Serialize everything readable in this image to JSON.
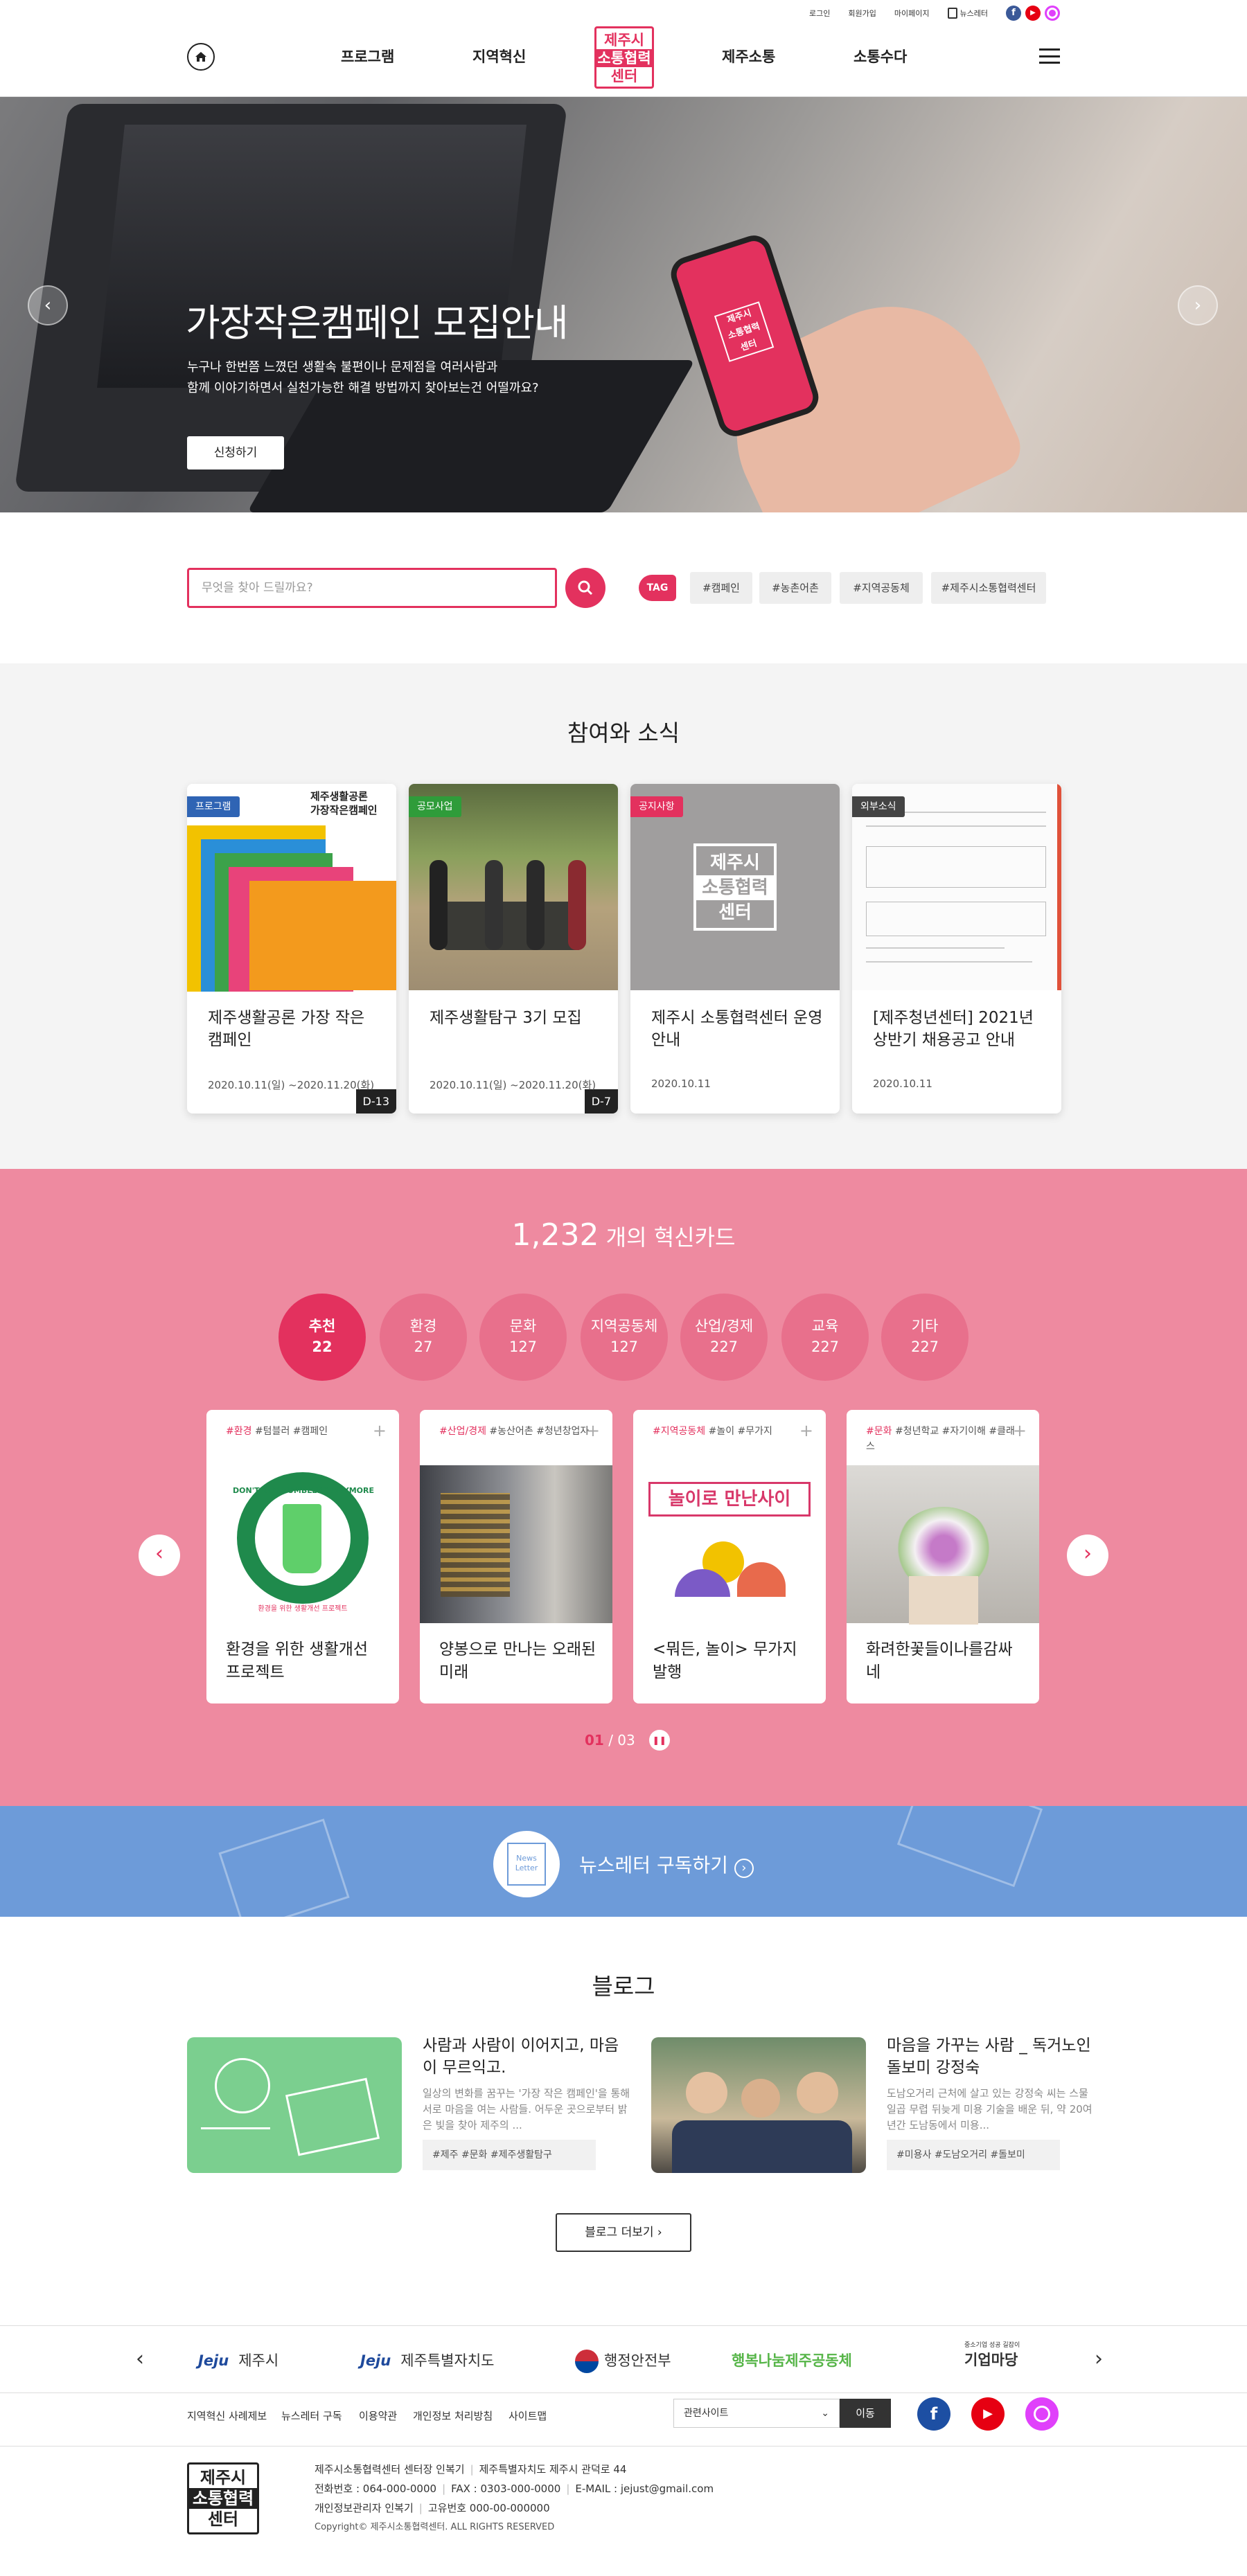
{
  "util": {
    "login": "로그인",
    "join": "회원가입",
    "mypage": "마이페이지",
    "newsletter": "뉴스레터"
  },
  "colors": {
    "accent": "#e3315e",
    "pink_bg": "#ee8aa0",
    "blue_bg": "#6d9bd9",
    "facebook": "#3b5998",
    "youtube": "#e60012",
    "instagram": "#e040fb"
  },
  "header": {
    "nav": [
      "프로그램",
      "지역혁신",
      "제주소통",
      "소통수다"
    ],
    "logo": [
      "제주시",
      "소통협력",
      "센터"
    ]
  },
  "hero": {
    "title": "가장작은캠페인 모집안내",
    "desc1": "누구나 한번쯤 느꼈던 생활속 불편이나 문제점을 여러사람과",
    "desc2": "함께 이야기하면서 실천가능한 해결 방법까지 찾아보는건 어떨까요?",
    "button": "신청하기",
    "slides": 5,
    "active_slide": 1
  },
  "search": {
    "placeholder": "무엇을 찾아 드릴까요?",
    "tag_label": "TAG",
    "tags": [
      "#캠페인",
      "#농촌어촌",
      "#지역공동체",
      "#제주시소통협력센터"
    ]
  },
  "news": {
    "title": "참여와 소식",
    "cards": [
      {
        "badge": "프로그램",
        "badge_color": "#2f64b4",
        "title": "제주생활공론 가장 작은 캠페인",
        "date": "2020.10.11(일) ~2020.11.20(화)",
        "dday": "D-13",
        "poster_title": "제주생활공론\n가장작은캠페인"
      },
      {
        "badge": "공모사업",
        "badge_color": "#2f9c3a",
        "title": "제주생활탐구 3기 모집",
        "date": "2020.10.11(일) ~2020.11.20(화)",
        "dday": "D-7"
      },
      {
        "badge": "공지사항",
        "badge_color": "#e3315e",
        "title": "제주시 소통협력센터 운영안내",
        "date": "2020.10.11",
        "dday": ""
      },
      {
        "badge": "외부소식",
        "badge_color": "#444444",
        "title": "[제주청년센터] 2021년 상반기 채용공고 안내",
        "date": "2020.10.11",
        "dday": ""
      }
    ]
  },
  "cards": {
    "count": "1,232",
    "count_suffix": "개의 혁신카드",
    "categories": [
      {
        "label": "추천",
        "count": "22"
      },
      {
        "label": "환경",
        "count": "27"
      },
      {
        "label": "문화",
        "count": "127"
      },
      {
        "label": "지역공동체",
        "count": "127"
      },
      {
        "label": "산업/경제",
        "count": "227"
      },
      {
        "label": "교육",
        "count": "227"
      },
      {
        "label": "기타",
        "count": "227"
      }
    ],
    "items": [
      {
        "main_tag": "#환경",
        "tags": "#텀블러 #캠페인",
        "title": "환경을 위한 생활개선 프로젝트",
        "img_text": "DON'T BUY TUMBLERS ANYMORE",
        "img_sub": "환경을 위한 생활개선 프로젝트"
      },
      {
        "main_tag": "#산업/경제",
        "tags": "#농산어촌 #청년창업자",
        "title": "양봉으로 만나는 오래된 미래"
      },
      {
        "main_tag": "#지역공동체",
        "tags": "#놀이 #무가지",
        "title": "<뭐든, 놀이> 무가지 발행",
        "img_text": "놀이로 만난사이"
      },
      {
        "main_tag": "#문화",
        "tags": "#청년학교 #자기이해 #클래스",
        "title": "화려한꽃들이나를감싸네"
      }
    ],
    "page_current": "01",
    "page_total": "03"
  },
  "newsletter": {
    "label": "뉴스레터 구독하기",
    "icon_text": "News Letter"
  },
  "blog": {
    "title": "블로그",
    "posts": [
      {
        "title": "사람과 사람이 이어지고, 마음이 무르익고.",
        "desc": "일상의 변화를 꿈꾸는 '가장 작은 캠페인'을 통해 서로 마음을 여는 사람들. 어두운 곳으로부터 밝은 빛을 찾아 제주의 ...",
        "tags": "#제주 #문화 #제주생활탐구"
      },
      {
        "title": "마음을 가꾸는 사람 _ 독거노인 돌보미 강정숙",
        "desc": "도남오거리 근처에 살고 있는 강정숙 씨는 스물 일곱 무렵 뒤늦게 미용 기술을 배운 뒤, 약 20여 년간 도남동에서 미용...",
        "tags": "#미용사 #도남오거리 #돌보미"
      }
    ],
    "more": "블로그 더보기"
  },
  "partners": [
    "제주시",
    "제주특별자치도",
    "행정안전부",
    "행복나눔제주공동체",
    "기업마당"
  ],
  "partner_sub": {
    "jeju": "Jeju",
    "bizmarket_sub": "중소기업 성공 길잡이"
  },
  "footer": {
    "links": [
      "지역혁신 사례제보",
      "뉴스레터 구독",
      "이용약관",
      "개인정보 처리방침",
      "사이트맵"
    ],
    "related": "관련사이트",
    "go": "이동",
    "logo": [
      "제주시",
      "소통협력",
      "센터"
    ],
    "org": "제주시소통협력센터",
    "ceo": "센터장 인복기",
    "addr": "제주특별자치도 제주시 관덕로 44",
    "tel": "전화번호 : 064-000-0000",
    "fax": "FAX : 0303-000-0000",
    "email": "E-MAIL : jejust@gmail.com",
    "privacy": "개인정보관리자 인복기",
    "bizno": "고유번호 000-00-000000",
    "copyright": "Copyright© 제주시소통협력센터. ALL RIGHTS RESERVED"
  }
}
